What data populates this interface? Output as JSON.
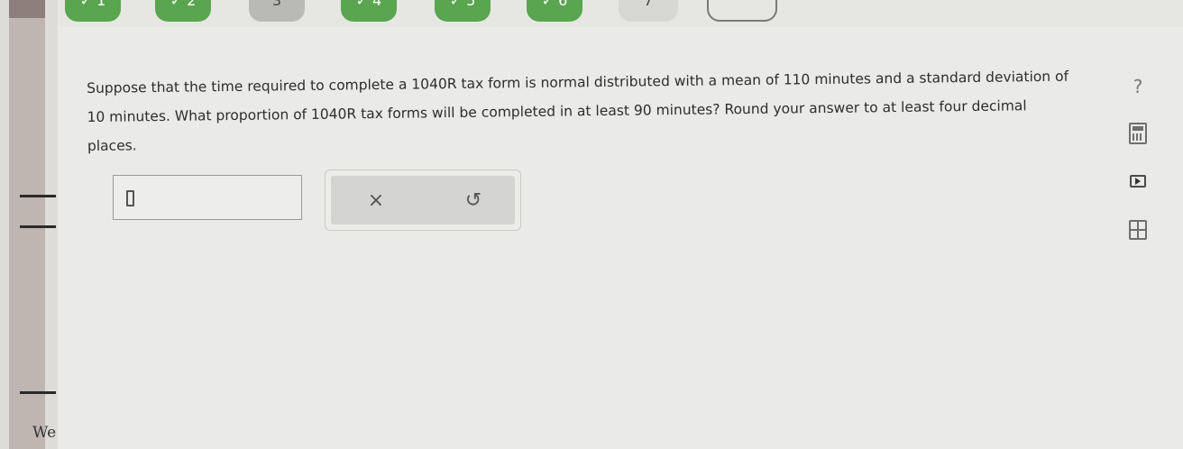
{
  "nav": {
    "steps": [
      {
        "label": "✓ 1",
        "state": "done"
      },
      {
        "label": "✓ 2",
        "state": "done"
      },
      {
        "label": "3",
        "state": "current"
      },
      {
        "label": "✓ 4",
        "state": "done"
      },
      {
        "label": "✓ 5",
        "state": "done"
      },
      {
        "label": "✓ 6",
        "state": "done"
      },
      {
        "label": "7",
        "state": "plain"
      },
      {
        "label": "",
        "state": "outline"
      }
    ]
  },
  "question": {
    "text": "Suppose that the time required to complete a 1040R tax form is normal distributed with a mean of 110 minutes and a standard deviation of 10 minutes. What proportion of 1040R tax forms will be completed in at least 90 minutes? Round your answer to at least four decimal places."
  },
  "answer": {
    "value": ""
  },
  "tools": {
    "clear_symbol": "×",
    "undo_symbol": "↺"
  },
  "side": {
    "help_symbol": "?",
    "icons": [
      "help-icon",
      "calculator-icon",
      "video-icon",
      "data-table-icon"
    ]
  },
  "background": {
    "left_text": "We"
  },
  "colors": {
    "done_step": "#5aa54f",
    "panel": "#eaeae8"
  }
}
